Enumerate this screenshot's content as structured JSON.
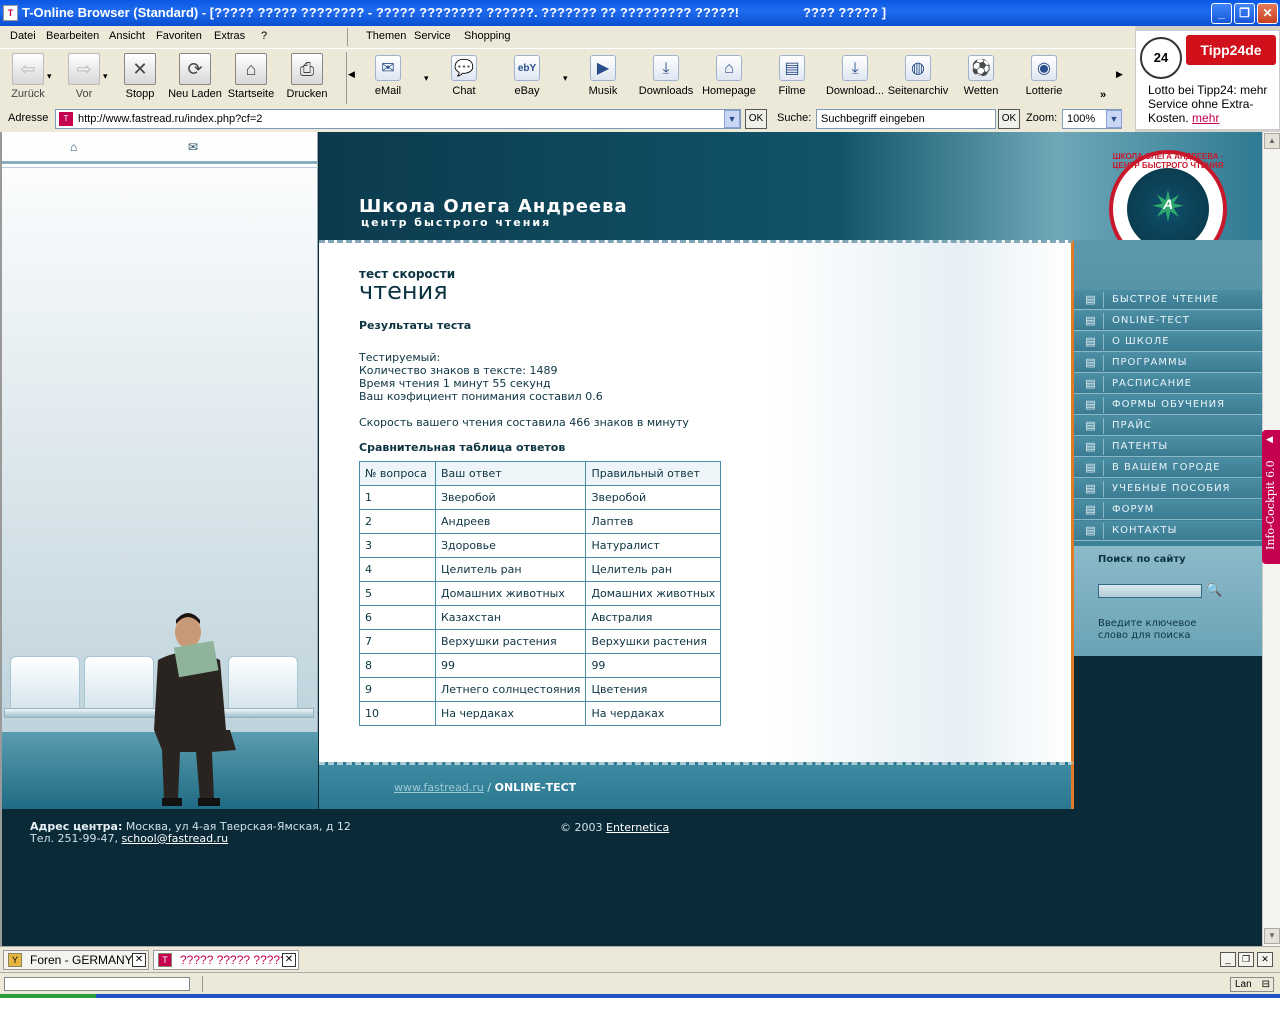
{
  "window": {
    "title": "T-Online Browser (Standard) - [????? ????? ???????? - ????? ???????? ??????. ??????? ?? ????????? ?????!",
    "title_right": "???? ????? ]",
    "min_btn": "_",
    "max_btn": "❐",
    "close_btn": "✕"
  },
  "menu": {
    "left": [
      "Datei",
      "Bearbeiten",
      "Ansicht",
      "Favoriten",
      "Extras",
      "?"
    ],
    "right": [
      "Themen",
      "Service",
      "Shopping"
    ]
  },
  "toolbar": {
    "nav": [
      {
        "label": "Zurück",
        "icon": "⇦"
      },
      {
        "label": "Vor",
        "icon": "⇨"
      },
      {
        "label": "Stopp",
        "icon": "✕"
      },
      {
        "label": "Neu Laden",
        "icon": "⟳"
      },
      {
        "label": "Startseite",
        "icon": "⌂"
      },
      {
        "label": "Drucken",
        "icon": "⎙"
      }
    ],
    "services": [
      {
        "label": "eMail",
        "icon": "✉"
      },
      {
        "label": "Chat",
        "icon": "💬"
      },
      {
        "label": "eBay",
        "icon": "ebY"
      },
      {
        "label": "Musik",
        "icon": "▶"
      },
      {
        "label": "Downloads",
        "icon": "⤓"
      },
      {
        "label": "Homepage",
        "icon": "⌂"
      },
      {
        "label": "Filme",
        "icon": "▤"
      },
      {
        "label": "Download...",
        "icon": "⤓"
      },
      {
        "label": "Seitenarchiv",
        "icon": "◍"
      },
      {
        "label": "Wetten",
        "icon": "⚽"
      },
      {
        "label": "Lotterie",
        "icon": "◉"
      }
    ],
    "overflow": "»"
  },
  "address": {
    "label": "Adresse",
    "url": "http://www.fastread.ru/index.php?cf=2",
    "ok": "OK",
    "search_label": "Suche:",
    "search_placeholder": "Suchbegriff eingeben",
    "zoom_label": "Zoom:",
    "zoom_value": "100%"
  },
  "ad": {
    "logo": "Tipp24de",
    "ball": "24",
    "text": "Lotto bei Tipp24: mehr Service ohne Extra-Kosten.",
    "link": "mehr"
  },
  "site": {
    "header_title": "Школа Олега Андреева",
    "header_subtitle": "центр быстрого чтения",
    "seal_text": "ШКОЛА ОЛЕГА АНДРЕЕВА · ЦЕНТР БЫСТРОГО ЧТЕНИЯ",
    "seal_letter": "A",
    "page_title_small": "тест скорости",
    "page_title_big": "чтения",
    "results_heading": "Результаты теста",
    "lines": [
      "Тестируемый:",
      "Количество знаков в тексте: 1489",
      "Время чтения 1 минут 55 секунд",
      "Ваш коэфициент понимания составил 0.6"
    ],
    "speed_line": "Скорость вашего чтения составила 466 знаков в минуту",
    "table_heading": "Сравнительная таблица ответов",
    "table": {
      "headers": [
        "№ вопроса",
        "Ваш ответ",
        "Правильный ответ"
      ],
      "rows": [
        [
          "1",
          "Зверобой",
          "Зверобой"
        ],
        [
          "2",
          "Андреев",
          "Лаптев"
        ],
        [
          "3",
          "Здоровье",
          "Натуралист"
        ],
        [
          "4",
          "Целитель ран",
          "Целитель ран"
        ],
        [
          "5",
          "Домашних животных",
          "Домашних животных"
        ],
        [
          "6",
          "Казахстан",
          "Австралия"
        ],
        [
          "7",
          "Верхушки растения",
          "Верхушки растения"
        ],
        [
          "8",
          "99",
          "99"
        ],
        [
          "9",
          "Летнего солнцестояния",
          "Цветения"
        ],
        [
          "10",
          "На чердаках",
          "На чердаках"
        ]
      ]
    },
    "crumb_link": "www.fastread.ru",
    "crumb_sep": "/",
    "crumb_current": "ONLINE-ТЕСТ",
    "nav": [
      "БЫСТРОЕ ЧТЕНИЕ",
      "ONLINE-ТЕСТ",
      "О ШКОЛЕ",
      "ПРОГРАММЫ",
      "РАСПИСАНИЕ",
      "ФОРМЫ ОБУЧЕНИЯ",
      "ПРАЙС",
      "ПАТЕНТЫ",
      "В ВАШЕМ ГОРОДЕ",
      "УЧЕБНЫЕ ПОСОБИЯ",
      "ФОРУМ",
      "КОНТАКТЫ"
    ],
    "site_search_heading": "Поиск по сайту",
    "site_search_hint": "Введите ключевое слово для поиска",
    "address_label": "Адрес центра:",
    "address_text": "Москва, ул 4-ая Тверская-Ямская, д 12",
    "phone_text": "Тел. 251-99-47,",
    "email": "school@fastread.ru",
    "copyright": "© 2003",
    "copyright_link": "Enternetica"
  },
  "cockpit": {
    "label": "Info-Cockpit 6.0",
    "arrow": "◀"
  },
  "tabs": [
    {
      "label": "Foren - GERMANY..."
    },
    {
      "label": "????? ????? ?????..."
    }
  ],
  "status": {
    "lan": "Lan"
  }
}
